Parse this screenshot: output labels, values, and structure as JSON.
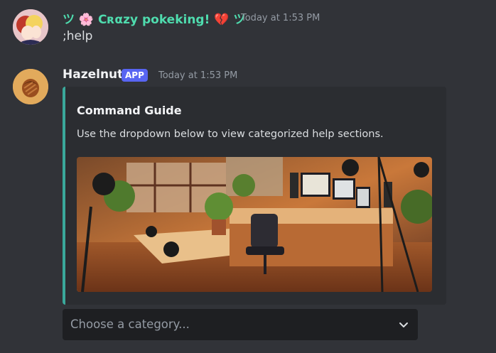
{
  "messages": [
    {
      "username": "ツ 🌸 Cʀαzу pokeking! 💔 ツ",
      "timestamp": "Today at 1:53 PM",
      "content": ";help"
    },
    {
      "username": "Hazelnut",
      "badge": "APP",
      "timestamp": "Today at 1:53 PM",
      "embed": {
        "title": "Command Guide",
        "description": "Use the dropdown below to view categorized help sections.",
        "image_alt": "Illustration of a cozy sunlit study room with desks, monitors, plants and a camera rig",
        "accent_color": "#3aa89b"
      },
      "select": {
        "placeholder": "Choose a category..."
      }
    }
  ],
  "colors": {
    "background": "#313338",
    "embed_bg": "#2b2d31",
    "username_1": "#4fdcae",
    "badge": "#5865f2"
  },
  "icons": {
    "avatar_1": "anime-avatar",
    "avatar_2": "hazelnut-avatar",
    "select": "chevron-down-icon"
  }
}
